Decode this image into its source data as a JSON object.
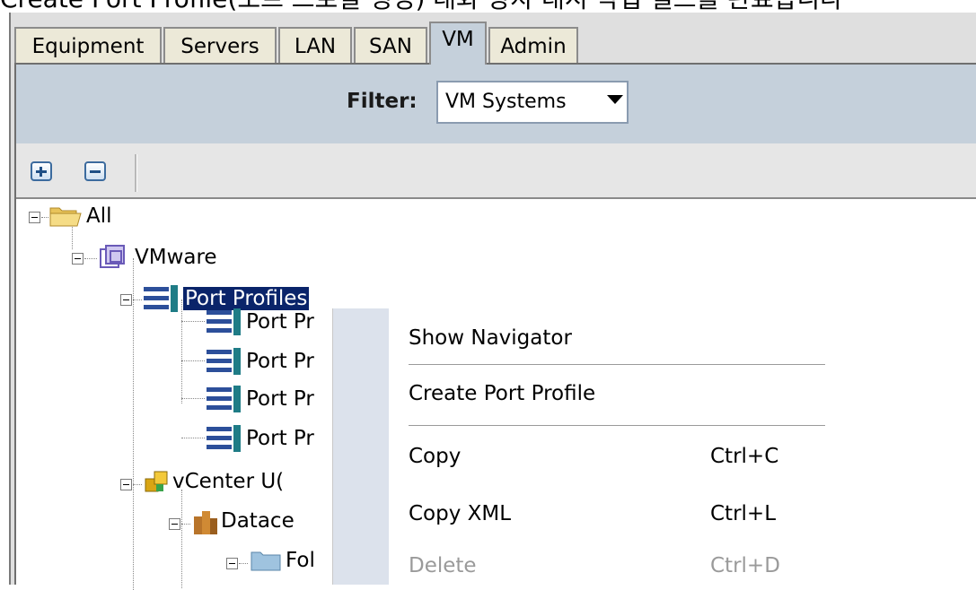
{
  "caption": "Create Port Profile(포트 프로필 생성) 대화 상자 대시 작업 필드를 완료합니다",
  "tabs": [
    "Equipment",
    "Servers",
    "LAN",
    "SAN",
    "VM",
    "Admin"
  ],
  "active_tab": "VM",
  "filter": {
    "label": "Filter:",
    "value": "VM Systems"
  },
  "toolbar": {
    "expand_icon": "plus-icon",
    "collapse_icon": "minus-icon"
  },
  "tree": {
    "all": "All",
    "vmware": "VMware",
    "port_profiles": "Port Profiles",
    "port_profile_children": [
      "Port Pr",
      "Port Pr",
      "Port Pr",
      "Port Pr"
    ],
    "vcenter": "vCenter U(",
    "datacenter": "Datace",
    "folder": "Fol"
  },
  "context_menu": {
    "items": [
      {
        "label": "Show Navigator",
        "shortcut": ""
      },
      {
        "label": "Create Port Profile",
        "shortcut": ""
      },
      {
        "label": "Copy",
        "shortcut": "Ctrl+C"
      },
      {
        "label": "Copy XML",
        "shortcut": "Ctrl+L"
      },
      {
        "label": "Delete",
        "shortcut": "Ctrl+D",
        "disabled": true
      }
    ]
  },
  "colors": {
    "tab_active": "#c5d0db",
    "filter_bar": "#c5d0db",
    "selection": "#0a246a",
    "menu_gutter": "#dce2ec"
  }
}
